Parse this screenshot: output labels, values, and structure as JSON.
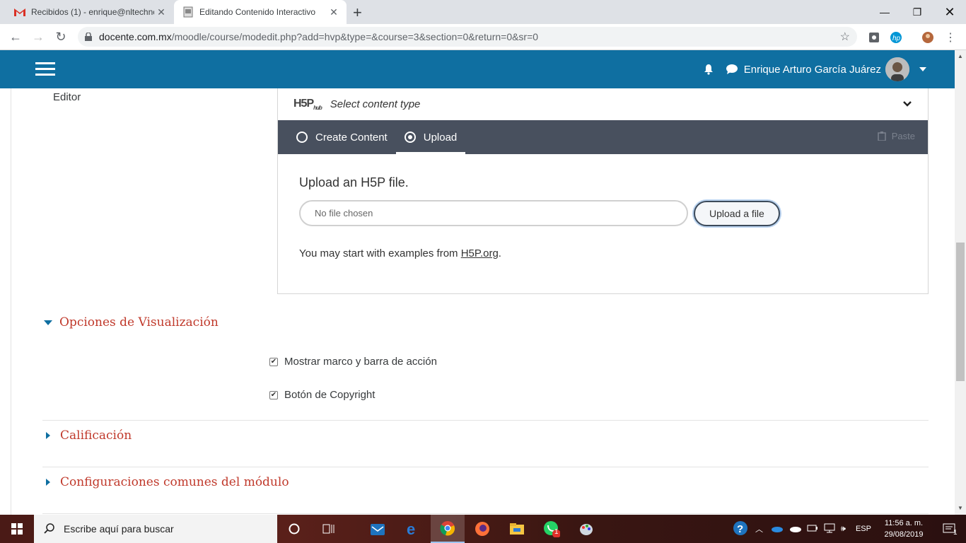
{
  "browser": {
    "tabs": [
      {
        "title": "Recibidos (1) - enrique@nltechnc",
        "close": "✕"
      },
      {
        "title": "Editando Contenido Interactivo",
        "close": "✕"
      }
    ],
    "new_tab": "+",
    "url_host": "docente.com.mx",
    "url_path": "/moodle/course/modedit.php?add=hvp&type=&course=3&section=0&return=0&sr=0"
  },
  "navbar": {
    "user_name": "Enrique Arturo García Juárez",
    "bg_color": "#0f6fa1"
  },
  "page": {
    "editor_label": "Editor",
    "h5p": {
      "logo": "H5P",
      "logo_sub": "hub",
      "select_label": "Select content type",
      "tabs": {
        "create": "Create Content",
        "upload": "Upload"
      },
      "paste": "Paste",
      "upload_heading": "Upload an H5P file.",
      "file_placeholder": "No file chosen",
      "upload_button": "Upload a file",
      "examples_prefix": "You may start with examples from ",
      "examples_link": "H5P.org",
      "examples_suffix": "."
    },
    "sections": {
      "display": "Opciones de Visualización",
      "grade": "Calificación",
      "common": "Configuraciones comunes del módulo"
    },
    "checkboxes": {
      "frame": "Mostrar marco y barra de acción",
      "copyright": "Botón de Copyright"
    },
    "accent_color": "#c0392b"
  },
  "taskbar": {
    "search_placeholder": "Escribe aquí para buscar",
    "lang": "ESP",
    "time": "11:56 a. m.",
    "date": "29/08/2019",
    "whatsapp_badge": "1",
    "notif_badge": "1"
  }
}
